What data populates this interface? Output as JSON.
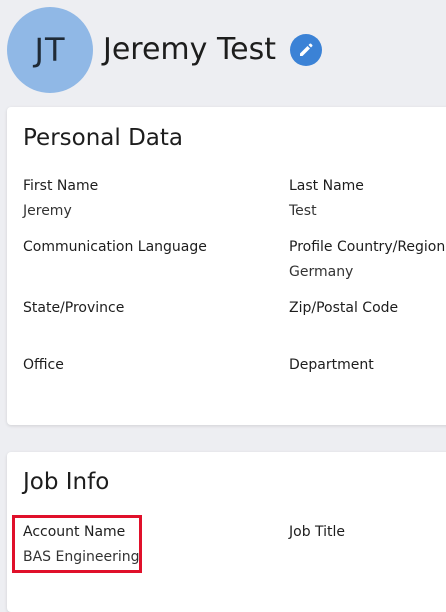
{
  "header": {
    "avatar_initials": "JT",
    "user_name": "Jeremy Test",
    "edit_icon": "pencil-icon",
    "colors": {
      "avatar_bg": "#90b8e6",
      "accent": "#3b82d6"
    }
  },
  "personal_data": {
    "title": "Personal Data",
    "fields": {
      "first_name": {
        "label": "First Name",
        "value": "Jeremy"
      },
      "last_name": {
        "label": "Last Name",
        "value": "Test"
      },
      "communication_language": {
        "label": "Communication Language",
        "value": ""
      },
      "profile_country": {
        "label": "Profile Country/Region",
        "value": "Germany"
      },
      "state_province": {
        "label": "State/Province",
        "value": ""
      },
      "zip_postal": {
        "label": "Zip/Postal Code",
        "value": ""
      },
      "office": {
        "label": "Office",
        "value": ""
      },
      "department": {
        "label": "Department",
        "value": ""
      }
    }
  },
  "job_info": {
    "title": "Job Info",
    "fields": {
      "account_name": {
        "label": "Account Name",
        "value": "BAS Engineering"
      },
      "job_title": {
        "label": "Job Title",
        "value": ""
      }
    }
  },
  "annotation": {
    "highlight_color": "#e0102a"
  }
}
